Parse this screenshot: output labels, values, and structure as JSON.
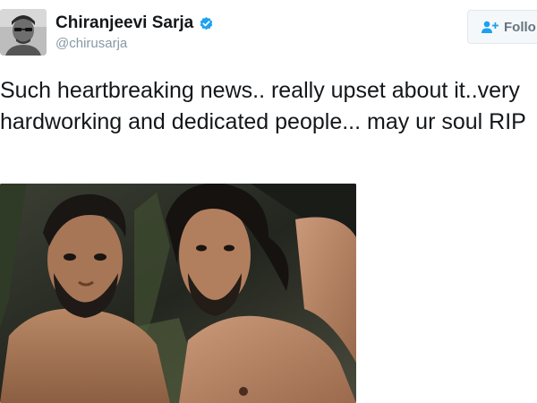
{
  "tweet": {
    "author": {
      "display_name": "Chiranjeevi Sarja",
      "handle": "@chirusarja",
      "verified": true,
      "avatar_icon": "profile-photo"
    },
    "follow_button": {
      "label": "Follo",
      "icon": "add-user-icon"
    },
    "text": "Such heartbreaking news.. really upset about it..very hardworking and dedicated people... may ur soul RIP",
    "media": {
      "type": "photo",
      "description_icon": "tweet-photo"
    }
  },
  "colors": {
    "verified_blue": "#1da1f2",
    "handle_gray": "#8899a6",
    "follow_text": "#66757f",
    "follow_border": "#e1e8ed",
    "text_dark": "#14171a"
  }
}
